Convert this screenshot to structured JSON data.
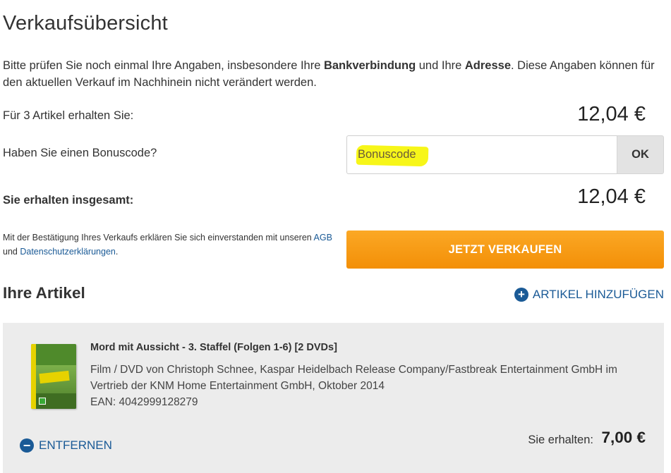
{
  "page": {
    "title": "Verkaufsübersicht"
  },
  "intro": {
    "part1": "Bitte prüfen Sie noch einmal Ihre Angaben, insbesondere Ihre ",
    "bold1": "Bankverbindung",
    "part2": " und Ihre ",
    "bold2": "Adresse",
    "part3": ". Diese Angaben können für den aktuellen Verkauf im Nachhinein nicht verändert werden."
  },
  "summary": {
    "items_label": "Für 3 Artikel erhalten Sie:",
    "items_amount": "12,04 €",
    "bonus_label": "Haben Sie einen Bonuscode?",
    "bonus_placeholder": "Bonuscode",
    "ok_label": "OK",
    "total_label": "Sie erhalten insgesamt:",
    "total_amount": "12,04 €"
  },
  "legal": {
    "text1": "Mit der Bestätigung Ihres Verkaufs erklären Sie sich einverstanden mit unseren ",
    "agb_link": "AGB",
    "text2": " und ",
    "privacy_link": "Datenschutzerklärungen",
    "text3": "."
  },
  "sell_button": "JETZT VERKAUFEN",
  "articles_section": {
    "title": "Ihre Artikel",
    "add_label": "ARTIKEL HINZUFÜGEN",
    "add_icon": "plus-circle-icon"
  },
  "article": {
    "title": "Mord mit Aussicht - 3. Staffel (Folgen 1-6) [2 DVDs]",
    "description": "Film / DVD von Christoph Schnee, Kaspar Heidelbach Release Company/Fastbreak Entertainment GmbH im Vertrieb der KNM Home Entertainment GmbH, Oktober 2014",
    "ean": "EAN: 4042999128279",
    "remove_label": "ENTFERNEN",
    "remove_icon": "minus-circle-icon",
    "receive_label": "Sie erhalten:",
    "receive_amount": "7,00 €"
  },
  "colors": {
    "accent_orange": "#f59b12",
    "link_blue": "#1a5a96",
    "card_gray": "#ececec"
  }
}
